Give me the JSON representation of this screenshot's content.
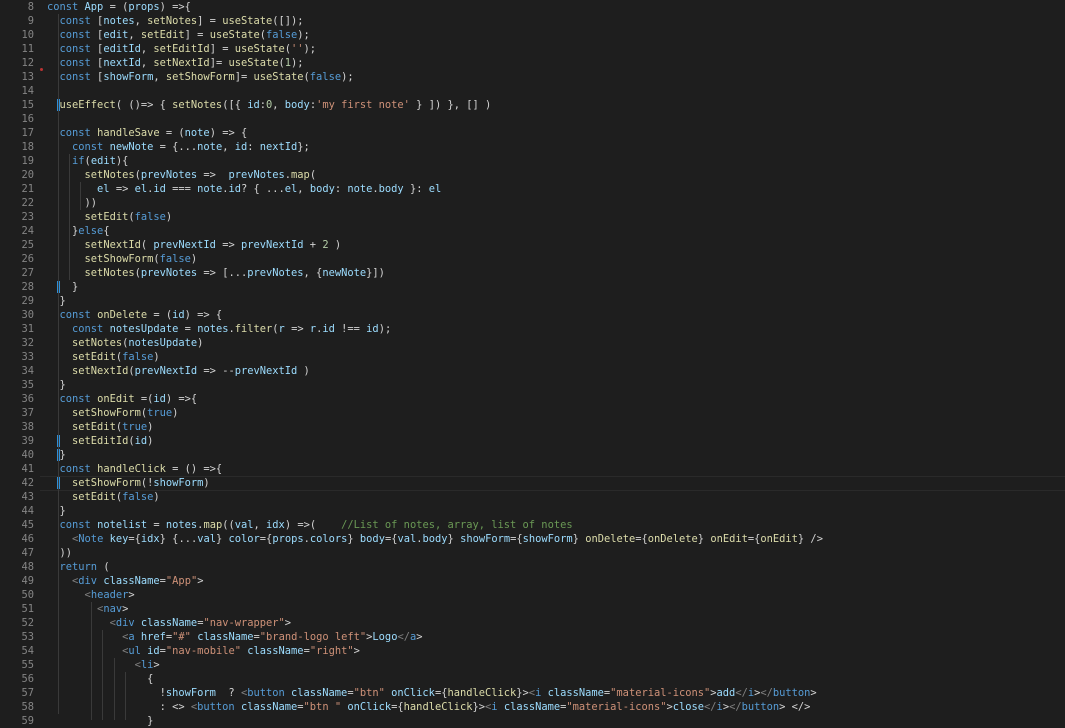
{
  "editor": {
    "first_line_number": 8,
    "current_line": 42,
    "modified_lines": [
      15,
      28,
      39,
      40,
      42
    ],
    "lines": [
      "const App = (props) =>{",
      "  const [notes, setNotes] = useState([]);",
      "  const [edit, setEdit] = useState(false);",
      "  const [editId, setEditId] = useState('');",
      "  const [nextId, setNextId]= useState(1);",
      "  const [showForm, setShowForm]= useState(false);",
      "",
      "  useEffect( ()=> { setNotes([{ id:0, body:'my first note' } ]) }, [] )",
      "",
      "  const handleSave = (note) => {",
      "    const newNote = {...note, id: nextId};",
      "    if(edit){",
      "      setNotes(prevNotes =>  prevNotes.map(",
      "        el => el.id === note.id? { ...el, body: note.body }: el",
      "      ))",
      "      setEdit(false)",
      "    }else{",
      "      setNextId( prevNextId => prevNextId + 2 )",
      "      setShowForm(false)",
      "      setNotes(prevNotes => [...prevNotes, {newNote}])",
      "    }",
      "  }",
      "  const onDelete = (id) => {",
      "    const notesUpdate = notes.filter(r => r.id !== id);",
      "    setNotes(notesUpdate)",
      "    setEdit(false)",
      "    setNextId(prevNextId => --prevNextId )",
      "  }",
      "  const onEdit =(id) =>{",
      "    setShowForm(true)",
      "    setEdit(true)",
      "    setEditId(id)",
      "  }",
      "  const handleClick = () =>{",
      "    setShowForm(!showForm)",
      "    setEdit(false)",
      "  }",
      "  const notelist = notes.map((val, idx) =>(    //List of notes, array, list of notes",
      "    <Note key={idx} {...val} color={props.colors} body={val.body} showForm={showForm} onDelete={onDelete} onEdit={onEdit} />",
      "  ))",
      "  return (",
      "    <div className=\"App\">",
      "      <header>",
      "        <nav>",
      "          <div className=\"nav-wrapper\">",
      "            <a href=\"#\" className=\"brand-logo left\">Logo</a>",
      "            <ul id=\"nav-mobile\" className=\"right\">",
      "              <li>",
      "                {",
      "                  !showForm  ? <button className=\"btn\" onClick={handleClick}><i className=\"material-icons\">add</i></button>",
      "                  : <> <button className=\"btn \" onClick={handleClick}><i className=\"material-icons\">close</i></button> </>",
      "                }"
    ]
  },
  "colors": {
    "background": "#1e1e1e",
    "line_number": "#858585",
    "text": "#d4d4d4",
    "keyword": "#569cd6",
    "string": "#ce9178",
    "number": "#b5cea8",
    "function": "#dcdcaa",
    "variable": "#9cdcfe",
    "tag": "#569cd6",
    "comment": "#6a9955",
    "modified_bar": "#2f8fd6"
  }
}
